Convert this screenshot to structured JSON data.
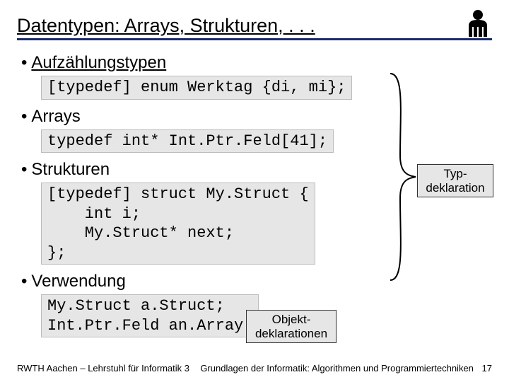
{
  "title": "Datentypen: Arrays, Strukturen, . . .",
  "bullets": {
    "b1": "Aufzählungstypen",
    "b2": "Arrays",
    "b3": "Strukturen",
    "b4": "Verwendung"
  },
  "code": {
    "enum": "[typedef] enum Werktag {di, mi};",
    "typedef": "typedef int* Int.Ptr.Feld[41];",
    "struct": "[typedef] struct My.Struct {\n    int i;\n    My.Struct* next;\n};",
    "usage": "My.Struct a.Struct;\nInt.Ptr.Feld an.Array;"
  },
  "labels": {
    "typ_l1": "Typ-",
    "typ_l2": "deklaration",
    "obj_l1": "Objekt-",
    "obj_l2": "deklarationen"
  },
  "footer": {
    "left": "RWTH Aachen – Lehrstuhl für Informatik 3",
    "right": "Grundlagen der Informatik: Algorithmen und Programmiertechniken",
    "page": "17"
  }
}
